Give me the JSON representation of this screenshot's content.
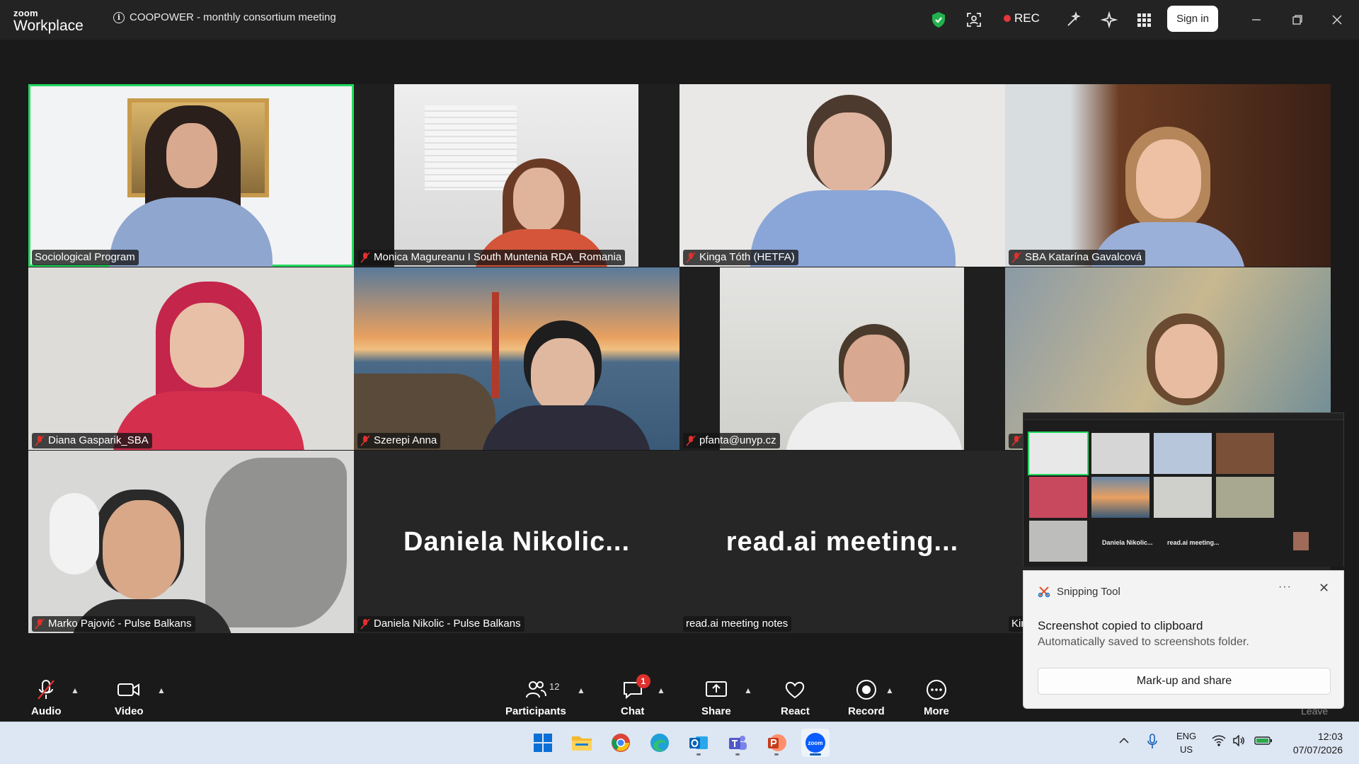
{
  "app": {
    "brand_top": "zoom",
    "brand_bottom": "Workplace"
  },
  "meeting": {
    "title": "COOPOWER - monthly consortium meeting"
  },
  "topbar": {
    "rec_label": "REC",
    "signin_label": "Sign in"
  },
  "colors": {
    "active_speaker": "#23d95e",
    "rec": "#e5363b",
    "badge": "#e0302c",
    "shield": "#23b14d"
  },
  "participants": [
    {
      "name": "Sociological Program",
      "muted": false,
      "active": true
    },
    {
      "name": "Monica Magureanu I South Muntenia RDA_Romania",
      "muted": true
    },
    {
      "name": "Kinga Tóth (HETFA)",
      "muted": true
    },
    {
      "name": "SBA Katarína Gavalcová",
      "muted": true
    },
    {
      "name": "Diana Gasparik_SBA",
      "muted": true
    },
    {
      "name": "Szerepi Anna",
      "muted": true
    },
    {
      "name": "pfanta@unyp.cz",
      "muted": true
    },
    {
      "name": "",
      "muted": true
    },
    {
      "name": "Marko Pajović - Pulse Balkans",
      "muted": true
    },
    {
      "name": "Daniela Nikolic - Pulse Balkans",
      "muted": true,
      "display": "Daniela  Nikolic..."
    },
    {
      "name": "read.ai meeting notes",
      "muted": false,
      "display": "read.ai  meeting..."
    },
    {
      "name": "Kir",
      "muted": false
    }
  ],
  "controls": {
    "audio": "Audio",
    "video": "Video",
    "participants": "Participants",
    "participants_count": "12",
    "chat": "Chat",
    "chat_badge": "1",
    "share": "Share",
    "react": "React",
    "record": "Record",
    "more": "More",
    "leave": "Leave"
  },
  "preview": {
    "tile_a": "Daniela  Nikolic...",
    "tile_b": "read.ai  meeting..."
  },
  "snipping": {
    "app_name": "Snipping Tool",
    "more": "···",
    "message": "Screenshot copied to clipboard",
    "sub": "Automatically saved to screenshots folder.",
    "button": "Mark-up and share"
  },
  "taskbar": {
    "apps": [
      "start-icon",
      "file-explorer-icon",
      "chrome-icon",
      "edge-icon",
      "outlook-icon",
      "teams-icon",
      "powerpoint-icon",
      "zoom-icon"
    ],
    "lang_top": "ENG",
    "lang_bottom": "US",
    "time": "12:03",
    "date": "07/07/2026"
  }
}
